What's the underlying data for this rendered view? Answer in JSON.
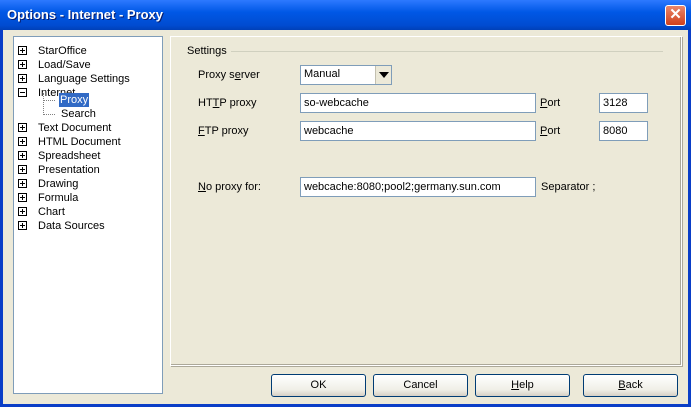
{
  "window": {
    "title": "Options - Internet - Proxy"
  },
  "tree": {
    "items": [
      {
        "label": "StarOffice",
        "expanded": false
      },
      {
        "label": "Load/Save",
        "expanded": false
      },
      {
        "label": "Language Settings",
        "expanded": false
      },
      {
        "label": "Internet",
        "expanded": true,
        "children": [
          "Proxy",
          "Search"
        ],
        "selected_child": "Proxy"
      },
      {
        "label": "Text Document",
        "expanded": false
      },
      {
        "label": "HTML Document",
        "expanded": false
      },
      {
        "label": "Spreadsheet",
        "expanded": false
      },
      {
        "label": "Presentation",
        "expanded": false
      },
      {
        "label": "Drawing",
        "expanded": false
      },
      {
        "label": "Formula",
        "expanded": false
      },
      {
        "label": "Chart",
        "expanded": false
      },
      {
        "label": "Data Sources",
        "expanded": false
      }
    ]
  },
  "settings": {
    "group_title": "Settings",
    "proxy_server": {
      "label_a": "Proxy s",
      "label_u": "e",
      "label_b": "rver",
      "value": "Manual"
    },
    "http_proxy": {
      "label_a": "HT",
      "label_u": "T",
      "label_b": "P proxy",
      "value": "so-webcache",
      "port_label_u": "P",
      "port_label_b": "ort",
      "port": "3128"
    },
    "ftp_proxy": {
      "label_u": "F",
      "label_b": "TP proxy",
      "value": "webcache",
      "port_label_u": "P",
      "port_label_b": "ort",
      "port": "8080"
    },
    "no_proxy": {
      "label_u": "N",
      "label_b": "o proxy for:",
      "value": "webcache:8080;pool2;germany.sun.com",
      "separator_label": "Separator ;"
    }
  },
  "buttons": {
    "ok": "OK",
    "cancel": "Cancel",
    "help_u": "H",
    "help_b": "elp",
    "back_u": "B",
    "back_b": "ack"
  }
}
